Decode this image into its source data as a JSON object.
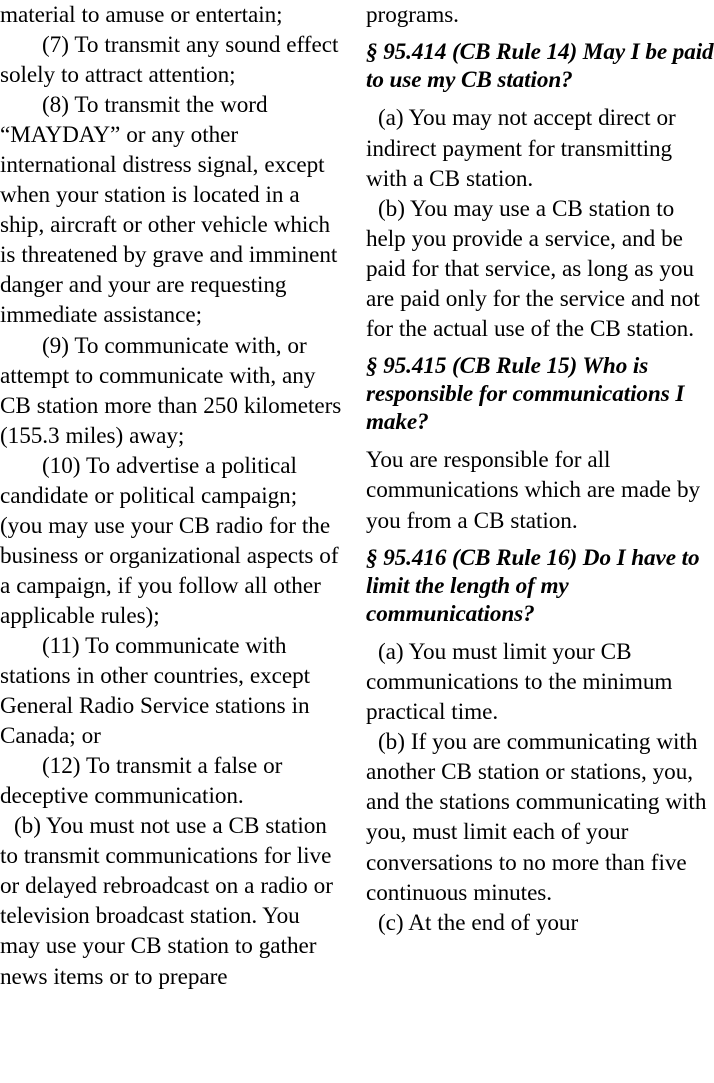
{
  "document": {
    "type": "regulation-page",
    "title_context": "47 CFR Part 95 — Citizens Band Radio Service rules",
    "columns": 2,
    "text_color": "#000000",
    "background_color": "#ffffff"
  },
  "left_column": {
    "blocks": [
      {
        "kind": "body-continued",
        "text": "material to amuse or entertain;"
      },
      {
        "kind": "numbered-item",
        "text": "(7) To transmit any sound effect solely to attract attention;"
      },
      {
        "kind": "numbered-item",
        "text": "(8) To transmit the word “MAYDAY” or any other international distress signal, except when your station is located in a ship, aircraft or other vehicle which is threatened by grave and imminent danger and your are requesting immediate assistance;"
      },
      {
        "kind": "numbered-item",
        "text": "(9) To communicate with, or attempt to communicate with, any CB station more than 250 kilometers (155.3 miles) away;"
      },
      {
        "kind": "numbered-item",
        "text": "(10) To advertise a political candidate or political campaign; (you may use your CB radio for the business or organizational aspects of a campaign, if you follow all other applicable rules);"
      },
      {
        "kind": "numbered-item",
        "text": "(11) To communicate with stations in other countries, except General Radio Service stations in Canada; or"
      },
      {
        "kind": "numbered-item",
        "text": "(12) To transmit a false or deceptive communication."
      },
      {
        "kind": "lettered-paragraph",
        "text": "(b) You must not use a CB station to transmit communications for live or delayed rebroadcast on a radio or television broadcast station. You may use your CB station to gather news items or to prepare"
      }
    ]
  },
  "right_column": {
    "blocks": [
      {
        "kind": "body-continued",
        "text": "programs."
      },
      {
        "kind": "heading",
        "text": "§ 95.414 (CB Rule 14) May I be paid to use my CB station?"
      },
      {
        "kind": "lettered-paragraph",
        "text": "(a) You may not accept direct or indirect payment for transmitting with a CB station."
      },
      {
        "kind": "lettered-paragraph",
        "text": "(b) You may use a CB station to help you provide a service, and be paid for that service, as long as you are paid only for the service and not for the actual use of the CB station."
      },
      {
        "kind": "heading",
        "text": "§ 95.415 (CB Rule 15) Who is responsible for communications I make?"
      },
      {
        "kind": "plain-paragraph",
        "text": "You are responsible for all communications which are made by you from a CB station."
      },
      {
        "kind": "heading",
        "text": "§ 95.416 (CB Rule 16) Do I have to limit the length of my communications?"
      },
      {
        "kind": "lettered-paragraph",
        "text": "(a) You must limit your CB communications to the minimum practical time."
      },
      {
        "kind": "lettered-paragraph",
        "text": "(b) If you are communicating with another CB station or stations, you, and the stations communicating with you, must limit each of your conversations to no more than five continuous minutes."
      },
      {
        "kind": "lettered-paragraph",
        "text": "(c) At the end of your"
      }
    ]
  }
}
